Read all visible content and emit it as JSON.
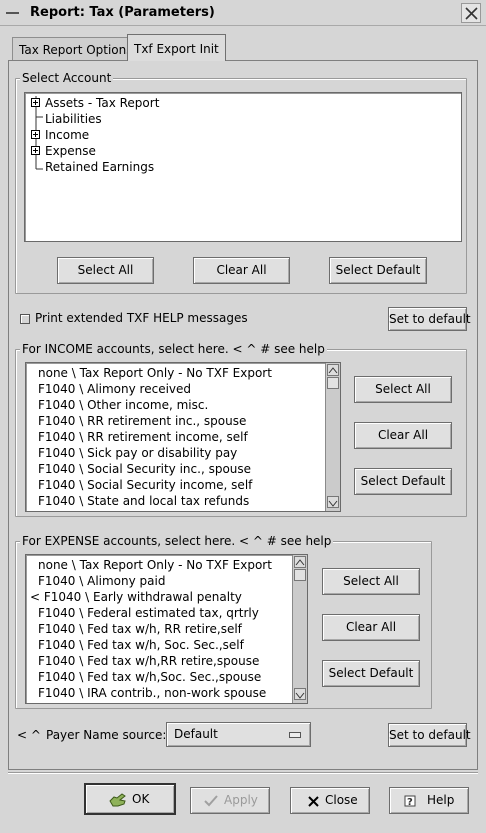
{
  "window": {
    "title": "Report: Tax (Parameters)"
  },
  "tabs": [
    {
      "label": "Tax Report Options"
    },
    {
      "label": "Txf Export Init"
    }
  ],
  "select_account": {
    "title": "Select Account",
    "tree": [
      {
        "label": "Assets - Tax Report",
        "expandable": true
      },
      {
        "label": "Liabilities",
        "expandable": false
      },
      {
        "label": "Income",
        "expandable": true
      },
      {
        "label": "Expense",
        "expandable": true
      },
      {
        "label": "Retained Earnings",
        "expandable": false
      }
    ],
    "buttons": {
      "select_all": "Select All",
      "clear_all": "Clear All",
      "select_default": "Select Default"
    }
  },
  "print_help": {
    "label": "Print extended TXF HELP messages",
    "checked": false,
    "set_default": "Set to default"
  },
  "income": {
    "title": "For INCOME accounts, select here.   < ^ # see help",
    "items": [
      "none \\ Tax Report Only - No TXF Export",
      "F1040 \\ Alimony received",
      "F1040 \\ Other income, misc.",
      "F1040 \\ RR retirement inc., spouse",
      "F1040 \\ RR retirement income, self",
      "F1040 \\ Sick pay or disability pay",
      "F1040 \\ Social Security inc., spouse",
      "F1040 \\ Social Security income, self",
      "F1040 \\ State and local tax refunds"
    ],
    "buttons": {
      "select_all": "Select All",
      "clear_all": "Clear All",
      "select_default": "Select Default"
    }
  },
  "expense": {
    "title": "For EXPENSE accounts, select here.   < ^ # see help",
    "items": [
      "none \\ Tax Report Only - No TXF Export",
      "F1040 \\ Alimony paid",
      "< F1040 \\ Early withdrawal penalty",
      "F1040 \\ Federal estimated tax, qrtrly",
      "F1040 \\ Fed tax w/h, RR retire,self",
      "F1040 \\ Fed tax w/h, Soc. Sec.,self",
      "F1040 \\ Fed tax w/h,RR retire,spouse",
      "F1040 \\ Fed tax w/h,Soc. Sec.,spouse",
      "F1040 \\ IRA contrib., non-work spouse"
    ],
    "buttons": {
      "select_all": "Select All",
      "clear_all": "Clear All",
      "select_default": "Select Default"
    }
  },
  "payer": {
    "prefix": "< ^",
    "label": "Payer Name source:",
    "value": "Default",
    "set_default": "Set to default"
  },
  "dialog_buttons": {
    "ok": "OK",
    "apply": "Apply",
    "close": "Close",
    "help": "Help"
  }
}
